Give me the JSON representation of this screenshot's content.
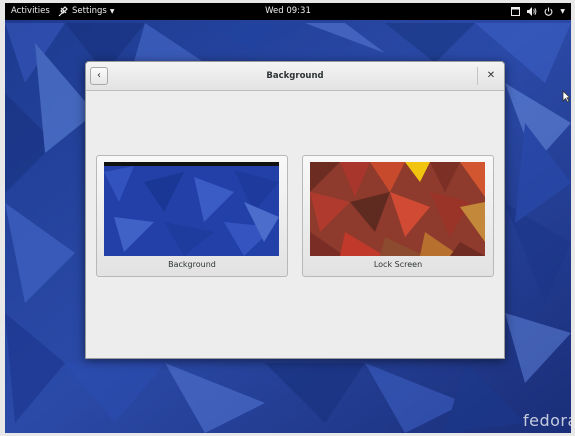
{
  "topbar": {
    "activities_label": "Activities",
    "app_menu_label": "Settings",
    "clock": "Wed 09:31"
  },
  "dialog": {
    "title": "Background",
    "back_icon": "chevron-left-icon",
    "close_icon": "close-icon",
    "options": [
      {
        "label": "Background"
      },
      {
        "label": "Lock Screen"
      }
    ]
  },
  "desktop": {
    "watermark": "fedora"
  },
  "colors": {
    "topbar": "#000000",
    "wallpaper_blue": "#2a43a0",
    "dialog_bg": "#ededed",
    "lockscreen_red": "#c0392b",
    "lockscreen_yellow": "#f1c40f"
  }
}
